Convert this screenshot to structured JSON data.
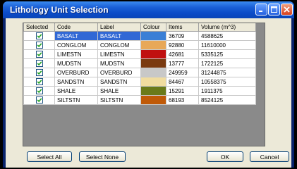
{
  "window": {
    "title": "Lithology Unit Selection"
  },
  "grid": {
    "headers": {
      "selected": "Selected",
      "code": "Code",
      "label": "Label",
      "colour": "Colour",
      "items": "Items",
      "volume": "Volume (m^3)"
    },
    "rows": [
      {
        "selected": true,
        "code": "BASALT",
        "label": "BASALT",
        "colour": "#3a7fd6",
        "items": "36709",
        "volume": "4588625",
        "highlighted": true
      },
      {
        "selected": true,
        "code": "CONGLOM",
        "label": "CONGLOM",
        "colour": "#e8a858",
        "items": "92880",
        "volume": "11610000"
      },
      {
        "selected": true,
        "code": "LIMESTN",
        "label": "LIMESTN",
        "colour": "#c01010",
        "items": "42681",
        "volume": "5335125"
      },
      {
        "selected": true,
        "code": "MUDSTN",
        "label": "MUDSTN",
        "colour": "#7a3a10",
        "items": "13777",
        "volume": "1722125"
      },
      {
        "selected": true,
        "code": "OVERBURD",
        "label": "OVERBURD",
        "colour": "#c8c8c8",
        "items": "249959",
        "volume": "31244875"
      },
      {
        "selected": true,
        "code": "SANDSTN",
        "label": "SANDSTN",
        "colour": "#f0dca0",
        "items": "84467",
        "volume": "10558375"
      },
      {
        "selected": true,
        "code": "SHALE",
        "label": "SHALE",
        "colour": "#6a7a1a",
        "items": "15291",
        "volume": "1911375"
      },
      {
        "selected": true,
        "code": "SILTSTN",
        "label": "SILTSTN",
        "colour": "#c05a08",
        "items": "68193",
        "volume": "8524125"
      }
    ]
  },
  "buttons": {
    "select_all": "Select All",
    "select_none": "Select None",
    "ok": "OK",
    "cancel": "Cancel"
  },
  "colors": {
    "titlebar": "#0b4bc7",
    "selection": "#3168d5",
    "dialog_bg": "#ece9d8",
    "grid_bg": "#8a8a8a"
  }
}
